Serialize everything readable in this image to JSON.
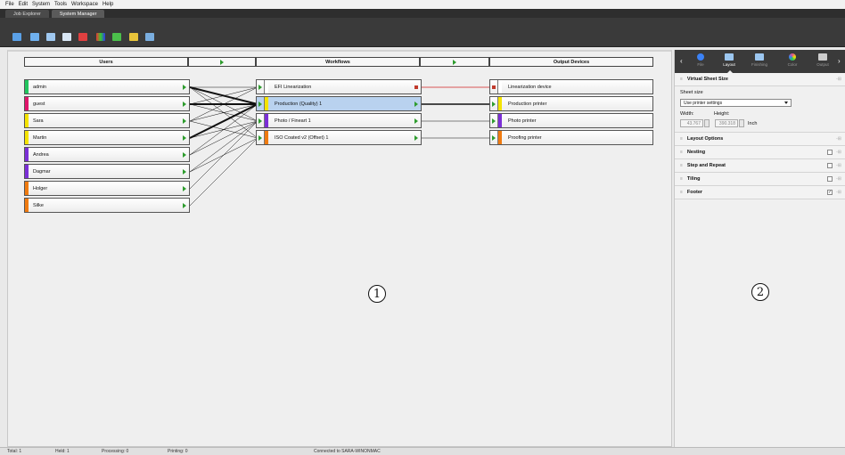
{
  "menu": [
    "File",
    "Edit",
    "System",
    "Tools",
    "Workspace",
    "Help"
  ],
  "tabs": [
    "Job Explorer",
    "System Manager"
  ],
  "toolbar_icons": [
    "add-user-icon",
    "edit-icon",
    "printer-icon",
    "stop-icon",
    "delete-icon",
    "color-icon",
    "check-icon",
    "chart-icon",
    "monitor-icon"
  ],
  "columns": {
    "users": "Users",
    "workflows": "Workflows",
    "outputs": "Output Devices"
  },
  "users": [
    {
      "name": "admin",
      "color": "#22c55e"
    },
    {
      "name": "guest",
      "color": "#e0156b"
    },
    {
      "name": "Sara",
      "color": "#f4e300"
    },
    {
      "name": "Martin",
      "color": "#f4e300"
    },
    {
      "name": "Andrea",
      "color": "#7b2fd6"
    },
    {
      "name": "Dagmar",
      "color": "#7b2fd6"
    },
    {
      "name": "Holger",
      "color": "#f07b10"
    },
    {
      "name": "Silke",
      "color": "#f07b10"
    }
  ],
  "workflows": [
    {
      "name": "EFI Linearization",
      "color": "#ffffff",
      "out": "red"
    },
    {
      "name": "Production (Quality) 1",
      "color": "#f4e300",
      "out": "green",
      "selected": true
    },
    {
      "name": "Photo / Fineart 1",
      "color": "#7b2fd6",
      "out": "green"
    },
    {
      "name": "ISO Coated v2 (Offset) 1",
      "color": "#f07b10",
      "out": "green"
    }
  ],
  "outputs": [
    {
      "name": "Linearization device",
      "color": "#ffffff",
      "in": "red"
    },
    {
      "name": "Production printer",
      "color": "#f4e300",
      "in": "green"
    },
    {
      "name": "Photo printer",
      "color": "#7b2fd6",
      "in": "green"
    },
    {
      "name": "Proofing printer",
      "color": "#f07b10",
      "in": "green"
    }
  ],
  "markers": {
    "left": "1",
    "right": "2"
  },
  "panel": {
    "tabs": [
      {
        "label": "File",
        "icon": "info-icon",
        "color": "#3b82f6"
      },
      {
        "label": "Layout",
        "icon": "layout-icon",
        "color": "#9cc7f0",
        "active": true
      },
      {
        "label": "Finishing",
        "icon": "finishing-icon",
        "color": "#9cc7f0"
      },
      {
        "label": "Color",
        "icon": "color-wheel-icon",
        "color": "#e34f8a"
      },
      {
        "label": "Output",
        "icon": "output-printer-icon",
        "color": "#cccccc"
      }
    ],
    "vss": {
      "title": "Virtual Sheet Size",
      "sheet_size_label": "Sheet size",
      "sheet_size_value": "Use printer settings",
      "width_label": "Width:",
      "height_label": "Height:",
      "width_value": "43.767",
      "height_value": "390.318",
      "unit": "Inch"
    },
    "sections": [
      {
        "title": "Layout Options",
        "checkbox": false,
        "checked": false
      },
      {
        "title": "Nesting",
        "checkbox": true,
        "checked": false
      },
      {
        "title": "Step and Repeat",
        "checkbox": true,
        "checked": false
      },
      {
        "title": "Tiling",
        "checkbox": true,
        "checked": false
      },
      {
        "title": "Footer",
        "checkbox": true,
        "checked": true
      }
    ]
  },
  "status": {
    "total": "Total: 1",
    "held": "Held: 1",
    "processing": "Processing: 0",
    "printing": "Printing: 0",
    "connected": "Connected to SARA-WINONMAC"
  }
}
